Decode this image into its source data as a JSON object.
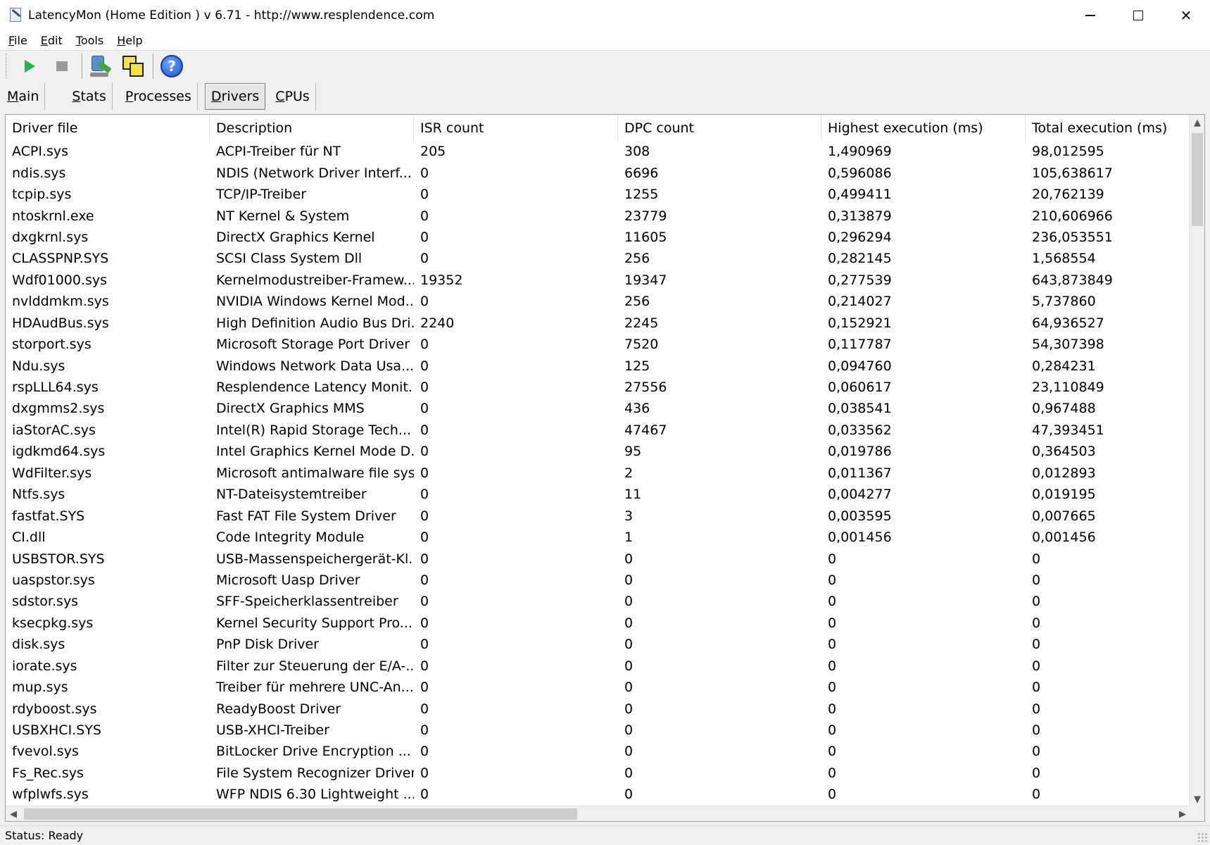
{
  "window": {
    "title": "LatencyMon  (Home Edition )  v 6.71 - http://www.resplendence.com",
    "controls": {
      "minimize": "minimize",
      "maximize": "maximize",
      "close": "✕"
    }
  },
  "menu": [
    {
      "underline": "F",
      "rest": "ile"
    },
    {
      "underline": "E",
      "rest": "dit"
    },
    {
      "underline": "T",
      "rest": "ools"
    },
    {
      "underline": "H",
      "rest": "elp"
    }
  ],
  "toolbar": {
    "buttons": [
      "play-icon",
      "stop-icon",
      "probe-icon",
      "windows-icon",
      "help-icon"
    ],
    "help_glyph": "?"
  },
  "tabs": [
    {
      "underline": "M",
      "rest": "ain",
      "active": false
    },
    {
      "underline": "S",
      "rest": "tats",
      "active": false
    },
    {
      "underline": "P",
      "rest": "rocesses",
      "active": false
    },
    {
      "underline": "D",
      "rest": "rivers",
      "active": true
    },
    {
      "underline": "C",
      "rest": "PUs",
      "active": false
    }
  ],
  "table": {
    "columns": [
      "Driver file",
      "Description",
      "ISR count",
      "DPC count",
      "Highest execution (ms)",
      "Total execution (ms)"
    ],
    "rows": [
      [
        "ACPI.sys",
        "ACPI-Treiber für NT",
        "205",
        "308",
        "1,490969",
        "98,012595"
      ],
      [
        "ndis.sys",
        "NDIS (Network Driver Interf...",
        "0",
        "6696",
        "0,596086",
        "105,638617"
      ],
      [
        "tcpip.sys",
        "TCP/IP-Treiber",
        "0",
        "1255",
        "0,499411",
        "20,762139"
      ],
      [
        "ntoskrnl.exe",
        "NT Kernel & System",
        "0",
        "23779",
        "0,313879",
        "210,606966"
      ],
      [
        "dxgkrnl.sys",
        "DirectX Graphics Kernel",
        "0",
        "11605",
        "0,296294",
        "236,053551"
      ],
      [
        "CLASSPNP.SYS",
        "SCSI Class System Dll",
        "0",
        "256",
        "0,282145",
        "1,568554"
      ],
      [
        "Wdf01000.sys",
        "Kernelmodustreiber-Framew...",
        "19352",
        "19347",
        "0,277539",
        "643,873849"
      ],
      [
        "nvlddmkm.sys",
        "NVIDIA Windows Kernel Mod...",
        "0",
        "256",
        "0,214027",
        "5,737860"
      ],
      [
        "HDAudBus.sys",
        "High Definition Audio Bus Dri...",
        "2240",
        "2245",
        "0,152921",
        "64,936527"
      ],
      [
        "storport.sys",
        "Microsoft Storage Port Driver",
        "0",
        "7520",
        "0,117787",
        "54,307398"
      ],
      [
        "Ndu.sys",
        "Windows Network Data Usa...",
        "0",
        "125",
        "0,094760",
        "0,284231"
      ],
      [
        "rspLLL64.sys",
        "Resplendence Latency Monit...",
        "0",
        "27556",
        "0,060617",
        "23,110849"
      ],
      [
        "dxgmms2.sys",
        "DirectX Graphics MMS",
        "0",
        "436",
        "0,038541",
        "0,967488"
      ],
      [
        "iaStorAC.sys",
        "Intel(R) Rapid Storage Tech...",
        "0",
        "47467",
        "0,033562",
        "47,393451"
      ],
      [
        "igdkmd64.sys",
        "Intel Graphics Kernel Mode D...",
        "0",
        "95",
        "0,019786",
        "0,364503"
      ],
      [
        "WdFilter.sys",
        "Microsoft antimalware file sys...",
        "0",
        "2",
        "0,011367",
        "0,012893"
      ],
      [
        "Ntfs.sys",
        "NT-Dateisystemtreiber",
        "0",
        "11",
        "0,004277",
        "0,019195"
      ],
      [
        "fastfat.SYS",
        "Fast FAT File System Driver",
        "0",
        "3",
        "0,003595",
        "0,007665"
      ],
      [
        "CI.dll",
        "Code Integrity Module",
        "0",
        "1",
        "0,001456",
        "0,001456"
      ],
      [
        "USBSTOR.SYS",
        "USB-Massenspeichergerät-Kl...",
        "0",
        "0",
        "0",
        "0"
      ],
      [
        "uaspstor.sys",
        "Microsoft Uasp Driver",
        "0",
        "0",
        "0",
        "0"
      ],
      [
        "sdstor.sys",
        "SFF-Speicherklassentreiber",
        "0",
        "0",
        "0",
        "0"
      ],
      [
        "ksecpkg.sys",
        "Kernel Security Support Pro...",
        "0",
        "0",
        "0",
        "0"
      ],
      [
        "disk.sys",
        "PnP Disk Driver",
        "0",
        "0",
        "0",
        "0"
      ],
      [
        "iorate.sys",
        "Filter zur Steuerung der E/A-...",
        "0",
        "0",
        "0",
        "0"
      ],
      [
        "mup.sys",
        "Treiber für mehrere UNC-An...",
        "0",
        "0",
        "0",
        "0"
      ],
      [
        "rdyboost.sys",
        "ReadyBoost Driver",
        "0",
        "0",
        "0",
        "0"
      ],
      [
        "USBXHCI.SYS",
        "USB-XHCI-Treiber",
        "0",
        "0",
        "0",
        "0"
      ],
      [
        "fvevol.sys",
        "BitLocker Drive Encryption ...",
        "0",
        "0",
        "0",
        "0"
      ],
      [
        "Fs_Rec.sys",
        "File System Recognizer Driver",
        "0",
        "0",
        "0",
        "0"
      ],
      [
        "wfplwfs.sys",
        "WFP NDIS 6.30 Lightweight ...",
        "0",
        "0",
        "0",
        "0"
      ]
    ]
  },
  "status": {
    "text": "Status: Ready"
  }
}
